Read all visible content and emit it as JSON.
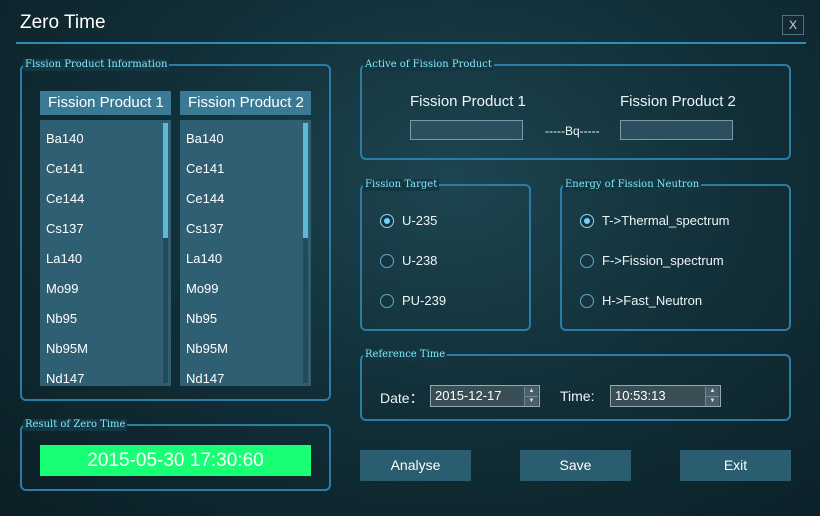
{
  "window": {
    "title": "Zero Time",
    "close_label": "X"
  },
  "info_group": {
    "label": "Fission Product Information",
    "list1": {
      "header": "Fission Product 1",
      "items": [
        "Ba140",
        "Ce141",
        "Ce144",
        "Cs137",
        "La140",
        "Mo99",
        "Nb95",
        "Nb95M",
        "Nd147"
      ]
    },
    "list2": {
      "header": "Fission Product 2",
      "items": [
        "Ba140",
        "Ce141",
        "Ce144",
        "Cs137",
        "La140",
        "Mo99",
        "Nb95",
        "Nb95M",
        "Nd147"
      ]
    }
  },
  "active_group": {
    "label": "Active of Fission Product",
    "product1_label": "Fission Product 1",
    "product2_label": "Fission Product 2",
    "product1_value": "",
    "product2_value": "",
    "unit_label": "-----Bq-----"
  },
  "target_group": {
    "label": "Fission Target",
    "options": [
      {
        "label": "U-235",
        "checked": true
      },
      {
        "label": "U-238",
        "checked": false
      },
      {
        "label": "PU-239",
        "checked": false
      }
    ]
  },
  "energy_group": {
    "label": "Energy of Fission Neutron",
    "options": [
      {
        "label": "T->Thermal_spectrum",
        "checked": true
      },
      {
        "label": "F->Fission_spectrum",
        "checked": false
      },
      {
        "label": "H->Fast_Neutron",
        "checked": false
      }
    ]
  },
  "reference_group": {
    "label": "Reference Time",
    "date_label": "Date：",
    "date_value": "2015-12-17",
    "time_label": "Time:",
    "time_value": "10:53:13"
  },
  "result_group": {
    "label": "Result of Zero Time",
    "value": "2015-05-30 17:30:60"
  },
  "buttons": {
    "analyse": "Analyse",
    "save": "Save",
    "exit": "Exit"
  },
  "colors": {
    "accent": "#2a7ea6",
    "result_bg": "#19ff75",
    "group_label": "#7fe9ff"
  }
}
